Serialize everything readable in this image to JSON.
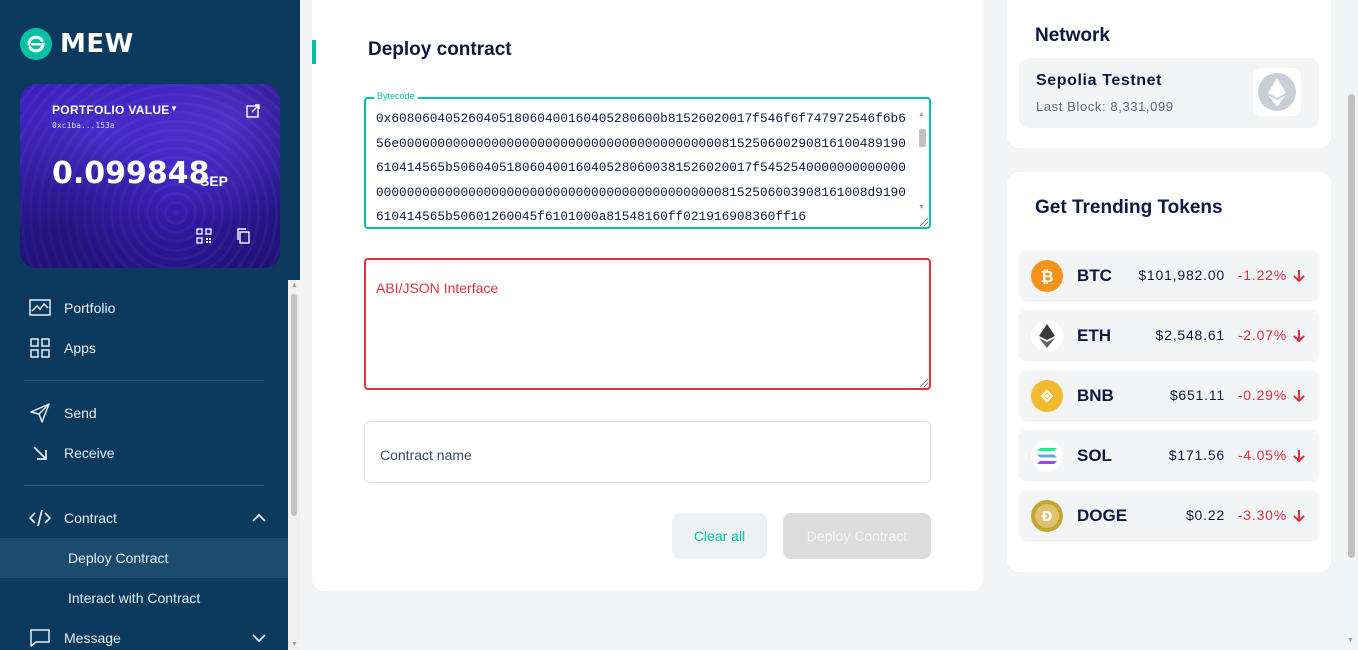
{
  "brand": {
    "name": "MEW"
  },
  "portfolio": {
    "label": "PORTFOLIO VALUE",
    "address": "0xc1ba...153a",
    "amount": "0.099848",
    "unit": "SEP"
  },
  "nav": {
    "portfolio": "Portfolio",
    "apps": "Apps",
    "send": "Send",
    "receive": "Receive",
    "contract": "Contract",
    "deploy_contract": "Deploy Contract",
    "interact_contract": "Interact with Contract",
    "message": "Message"
  },
  "main": {
    "title": "Deploy contract",
    "bytecode_label": "Bytecode",
    "bytecode_value": "0x6080604052604051806040016040528060​0b81526020017f546f6f747972546f6b656e00000000000000000000000000000000000000000081525060029081610048919061041456​5b506040518060400160405280600381526020017f5452540000000000000000000000000000000000000000000000000000000000815250600390816100​8d91906104145​65b50601260045f6101000a81548160ff021916908360ff16",
    "abi_placeholder": "ABI/JSON Interface",
    "name_placeholder": "Contract name",
    "clear_button": "Clear all",
    "deploy_button": "Deploy Contract"
  },
  "network": {
    "title": "Network",
    "name": "Sepolia Testnet",
    "last_block": "Last Block: 8,331,099"
  },
  "trending": {
    "title": "Get Trending Tokens",
    "tokens": [
      {
        "symbol": "BTC",
        "price": "$101,982.00",
        "change": "-1.22%",
        "icon": "bitcoin-icon",
        "color": "#f7931a"
      },
      {
        "symbol": "ETH",
        "price": "$2,548.61",
        "change": "-2.07%",
        "icon": "ethereum-icon",
        "color": "#3c3c3d"
      },
      {
        "symbol": "BNB",
        "price": "$651.11",
        "change": "-0.29%",
        "icon": "bnb-icon",
        "color": "#f3ba2f"
      },
      {
        "symbol": "SOL",
        "price": "$171.56",
        "change": "-4.05%",
        "icon": "solana-icon",
        "color": "#9945ff"
      },
      {
        "symbol": "DOGE",
        "price": "$0.22",
        "change": "-3.30%",
        "icon": "dogecoin-icon",
        "color": "#c2a633"
      }
    ]
  },
  "colors": {
    "accent": "#05c0a5",
    "sidebar": "#0b3a5e",
    "error": "#e0323f",
    "negative": "#e0323f"
  }
}
